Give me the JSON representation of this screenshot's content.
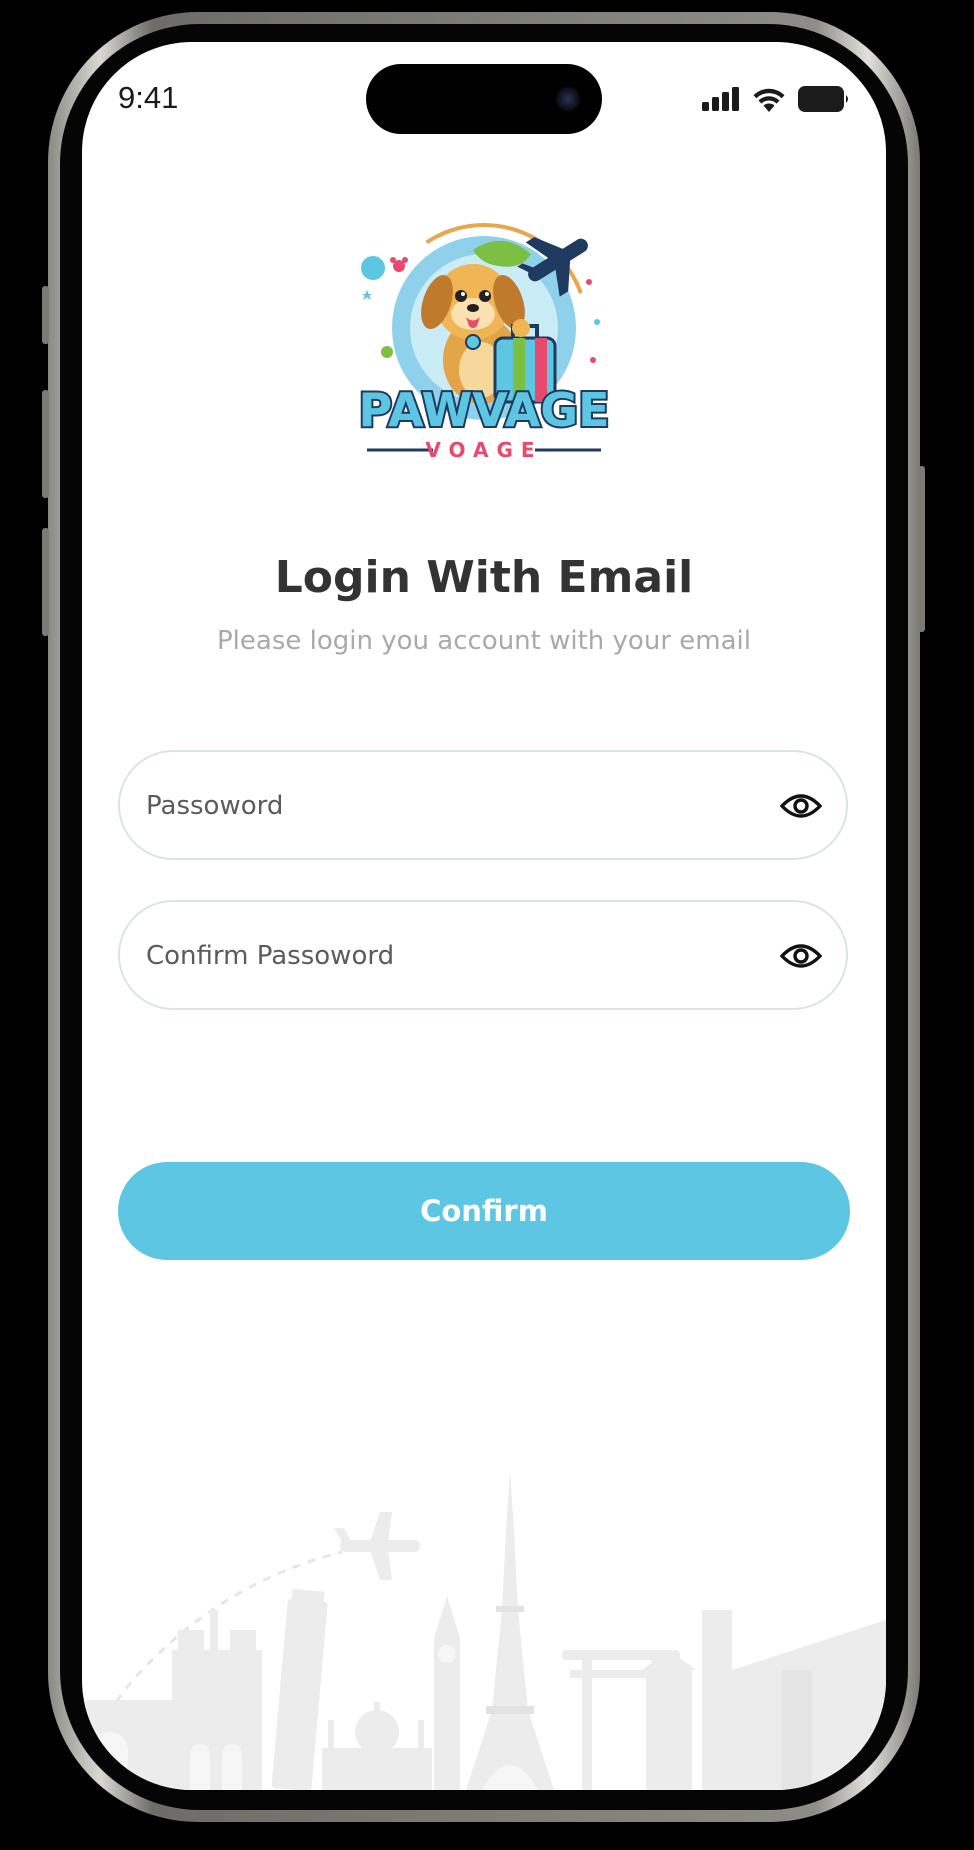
{
  "status_bar": {
    "time": "9:41"
  },
  "logo": {
    "brand_text": "PAWVAGE",
    "sub_text": "VOAGE"
  },
  "header": {
    "title": "Login With Email",
    "subtitle": "Please login you account with your email"
  },
  "form": {
    "password": {
      "placeholder": "Passoword",
      "value": ""
    },
    "confirm_password": {
      "placeholder": "Confirm Passoword",
      "value": ""
    }
  },
  "actions": {
    "confirm_label": "Confirm"
  },
  "colors": {
    "accent": "#5cc6e3",
    "title": "#333333",
    "subtitle": "#a9a9a9",
    "field_border": "#dbe4e4"
  }
}
